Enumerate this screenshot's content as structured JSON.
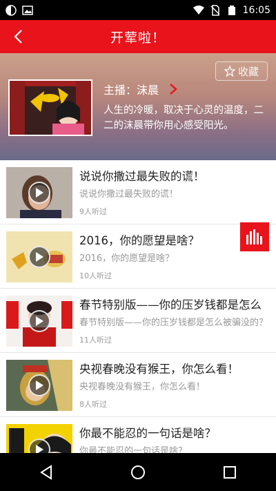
{
  "status_bar": {
    "time": "16:05"
  },
  "app_bar": {
    "title": "开荤啦！"
  },
  "header": {
    "favorite_label": "收藏",
    "host": "主播：沫晨",
    "description": "人生的冷暖，取决于心灵的温度，二二的沫晨带你用心感受阳光。"
  },
  "episodes": [
    {
      "title": "说说你撒过最失败的谎！",
      "subtitle": "说说你撒过最失败的谎！",
      "count": "9人听过"
    },
    {
      "title": "2016，你的愿望是啥？",
      "subtitle": "2016，你的愿望是啥？",
      "count": "10人听过"
    },
    {
      "title": "春节特别版——你的压岁钱都是怎么",
      "subtitle": "春节特别版——你的压岁钱都是怎么被骗没的？",
      "count": "11人听过"
    },
    {
      "title": "央视春晚没有猴王，你怎么看！",
      "subtitle": "央视春晚没有猴王，你怎么看！",
      "count": "8人听过"
    },
    {
      "title": "你最不能忍的一句话是啥？",
      "subtitle": "你最不能忍的一句话是啥？",
      "count": ""
    }
  ],
  "colors": {
    "accent": "#e8131b"
  }
}
